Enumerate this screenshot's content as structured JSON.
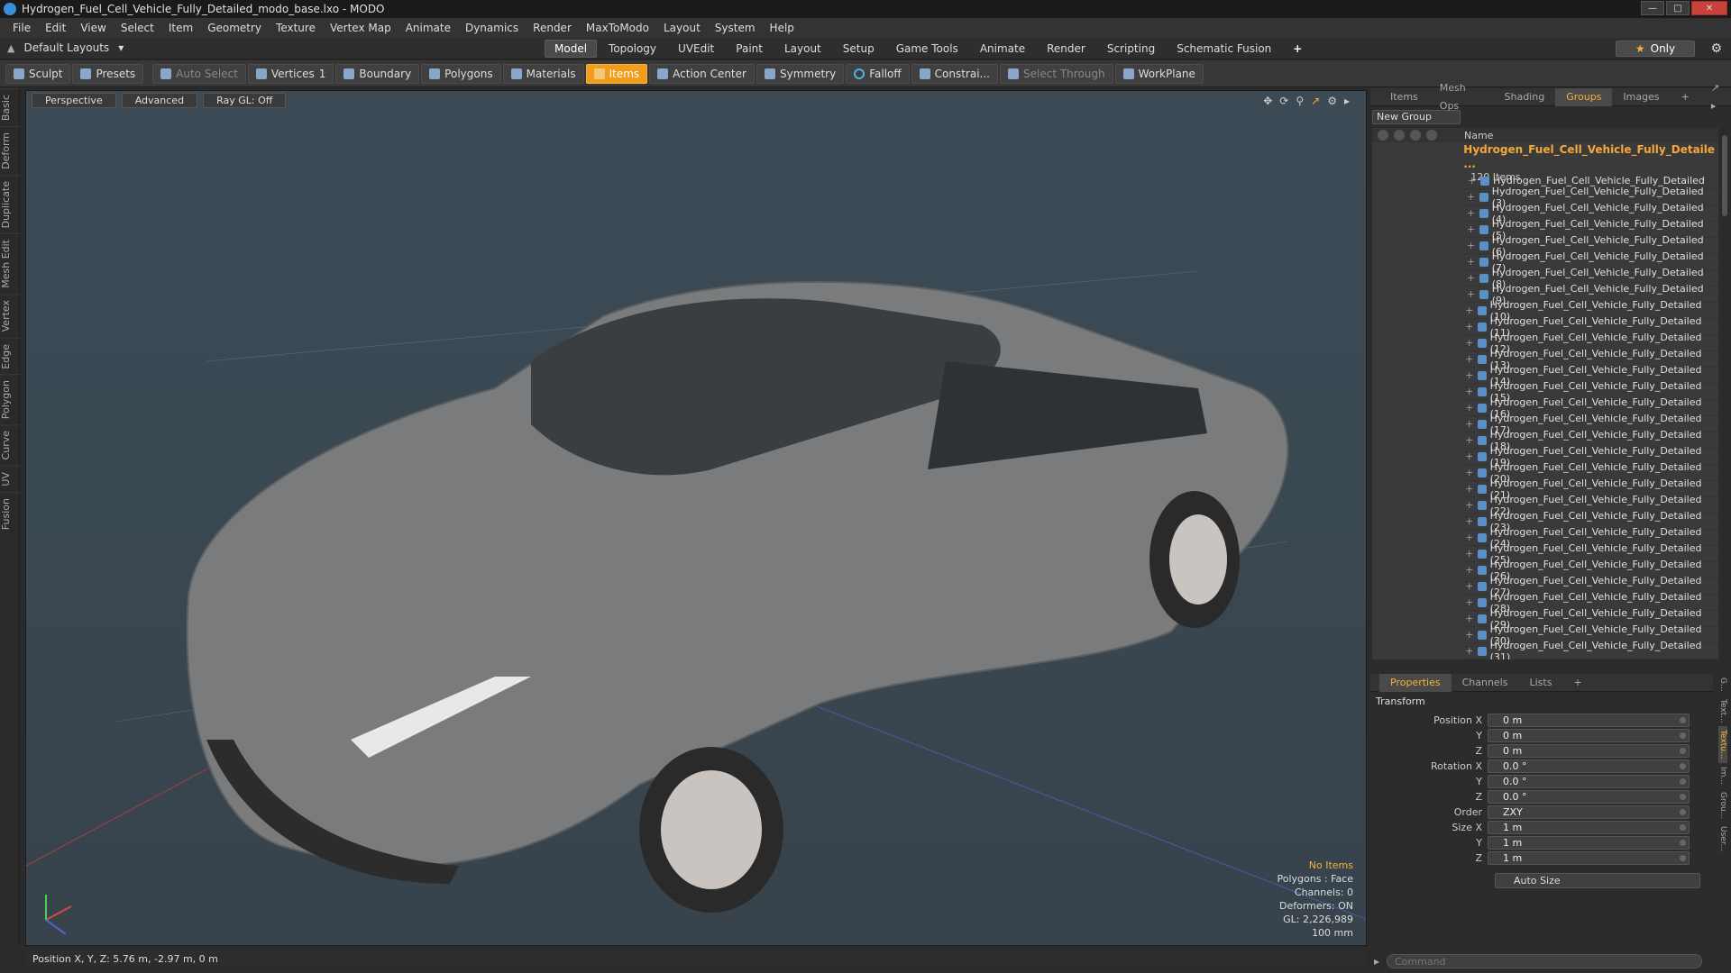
{
  "window": {
    "title": "Hydrogen_Fuel_Cell_Vehicle_Fully_Detailed_modo_base.lxo - MODO"
  },
  "menu": [
    "File",
    "Edit",
    "View",
    "Select",
    "Item",
    "Geometry",
    "Texture",
    "Vertex Map",
    "Animate",
    "Dynamics",
    "Render",
    "MaxToModo",
    "Layout",
    "System",
    "Help"
  ],
  "layouts": {
    "label": "Default Layouts"
  },
  "mode_tabs": [
    "Model",
    "Topology",
    "UVEdit",
    "Paint",
    "Layout",
    "Setup",
    "Game Tools",
    "Animate",
    "Render",
    "Scripting",
    "Schematic Fusion"
  ],
  "active_mode": "Model",
  "only_label": "Only",
  "toolbar": {
    "sculpt": "Sculpt",
    "presets": "Presets",
    "auto_select": "Auto Select",
    "vertices": "Vertices",
    "vertices_count": "1",
    "boundary": "Boundary",
    "polygons": "Polygons",
    "materials": "Materials",
    "items": "Items",
    "action_center": "Action Center",
    "symmetry": "Symmetry",
    "falloff": "Falloff",
    "constrain": "Constrai...",
    "select_through": "Select Through",
    "workplane": "WorkPlane"
  },
  "left_tabs": [
    "Basic",
    "Deform",
    "Duplicate",
    "Mesh Edit",
    "Vertex",
    "Edge",
    "Polygon",
    "Curve",
    "UV",
    "Fusion"
  ],
  "viewport": {
    "view": "Perspective",
    "shading": "Advanced",
    "raygl": "Ray GL: Off",
    "info": {
      "selection": "No Items",
      "polygons": "Polygons : Face",
      "channels": "Channels: 0",
      "deformers": "Deformers: ON",
      "gl": "GL: 2,226,989",
      "scale": "100 mm"
    }
  },
  "status": {
    "position": "Position X, Y, Z:   5.76 m, -2.97 m, 0 m"
  },
  "right_tabs": [
    "Items",
    "Mesh Ops",
    "Shading",
    "Groups",
    "Images"
  ],
  "active_right_tab": "Groups",
  "groups": {
    "new_group": "New Group",
    "name_header": "Name",
    "group_name": "Hydrogen_Fuel_Cell_Vehicle_Fully_Detaile ...",
    "count": "120 Items",
    "items": [
      "Hydrogen_Fuel_Cell_Vehicle_Fully_Detailed",
      "Hydrogen_Fuel_Cell_Vehicle_Fully_Detailed (3)",
      "Hydrogen_Fuel_Cell_Vehicle_Fully_Detailed (4)",
      "Hydrogen_Fuel_Cell_Vehicle_Fully_Detailed (5)",
      "Hydrogen_Fuel_Cell_Vehicle_Fully_Detailed (6)",
      "Hydrogen_Fuel_Cell_Vehicle_Fully_Detailed (7)",
      "Hydrogen_Fuel_Cell_Vehicle_Fully_Detailed (8)",
      "Hydrogen_Fuel_Cell_Vehicle_Fully_Detailed (9)",
      "Hydrogen_Fuel_Cell_Vehicle_Fully_Detailed (10)",
      "Hydrogen_Fuel_Cell_Vehicle_Fully_Detailed (11)",
      "Hydrogen_Fuel_Cell_Vehicle_Fully_Detailed (12)",
      "Hydrogen_Fuel_Cell_Vehicle_Fully_Detailed (13)",
      "Hydrogen_Fuel_Cell_Vehicle_Fully_Detailed (14)",
      "Hydrogen_Fuel_Cell_Vehicle_Fully_Detailed (15)",
      "Hydrogen_Fuel_Cell_Vehicle_Fully_Detailed (16)",
      "Hydrogen_Fuel_Cell_Vehicle_Fully_Detailed (17)",
      "Hydrogen_Fuel_Cell_Vehicle_Fully_Detailed (18)",
      "Hydrogen_Fuel_Cell_Vehicle_Fully_Detailed (19)",
      "Hydrogen_Fuel_Cell_Vehicle_Fully_Detailed (20)",
      "Hydrogen_Fuel_Cell_Vehicle_Fully_Detailed (21)",
      "Hydrogen_Fuel_Cell_Vehicle_Fully_Detailed (22)",
      "Hydrogen_Fuel_Cell_Vehicle_Fully_Detailed (23)",
      "Hydrogen_Fuel_Cell_Vehicle_Fully_Detailed (24)",
      "Hydrogen_Fuel_Cell_Vehicle_Fully_Detailed (25)",
      "Hydrogen_Fuel_Cell_Vehicle_Fully_Detailed (26)",
      "Hydrogen_Fuel_Cell_Vehicle_Fully_Detailed (27)",
      "Hydrogen_Fuel_Cell_Vehicle_Fully_Detailed (28)",
      "Hydrogen_Fuel_Cell_Vehicle_Fully_Detailed (29)",
      "Hydrogen_Fuel_Cell_Vehicle_Fully_Detailed (30)",
      "Hydrogen_Fuel_Cell_Vehicle_Fully_Detailed (31)"
    ]
  },
  "properties": {
    "tabs": [
      "Properties",
      "Channels",
      "Lists"
    ],
    "section": "Transform",
    "rows": [
      {
        "label": "Position X",
        "value": "0 m"
      },
      {
        "label": "Y",
        "value": "0 m"
      },
      {
        "label": "Z",
        "value": "0 m"
      },
      {
        "label": "Rotation X",
        "value": "0.0 °"
      },
      {
        "label": "Y",
        "value": "0.0 °"
      },
      {
        "label": "Z",
        "value": "0.0 °"
      },
      {
        "label": "Order",
        "value": "ZXY"
      },
      {
        "label": "Size X",
        "value": "1 m"
      },
      {
        "label": "Y",
        "value": "1 m"
      },
      {
        "label": "Z",
        "value": "1 m"
      }
    ],
    "auto_size": "Auto Size",
    "side_tabs": [
      "G...",
      "Text...",
      "Textu...",
      "Im...",
      "Grou...",
      "User..."
    ]
  },
  "command": {
    "placeholder": "Command"
  },
  "colors": {
    "accent": "#f29c1b",
    "group_name": "#f4a83a",
    "viewport_bg": "#3a4852"
  }
}
